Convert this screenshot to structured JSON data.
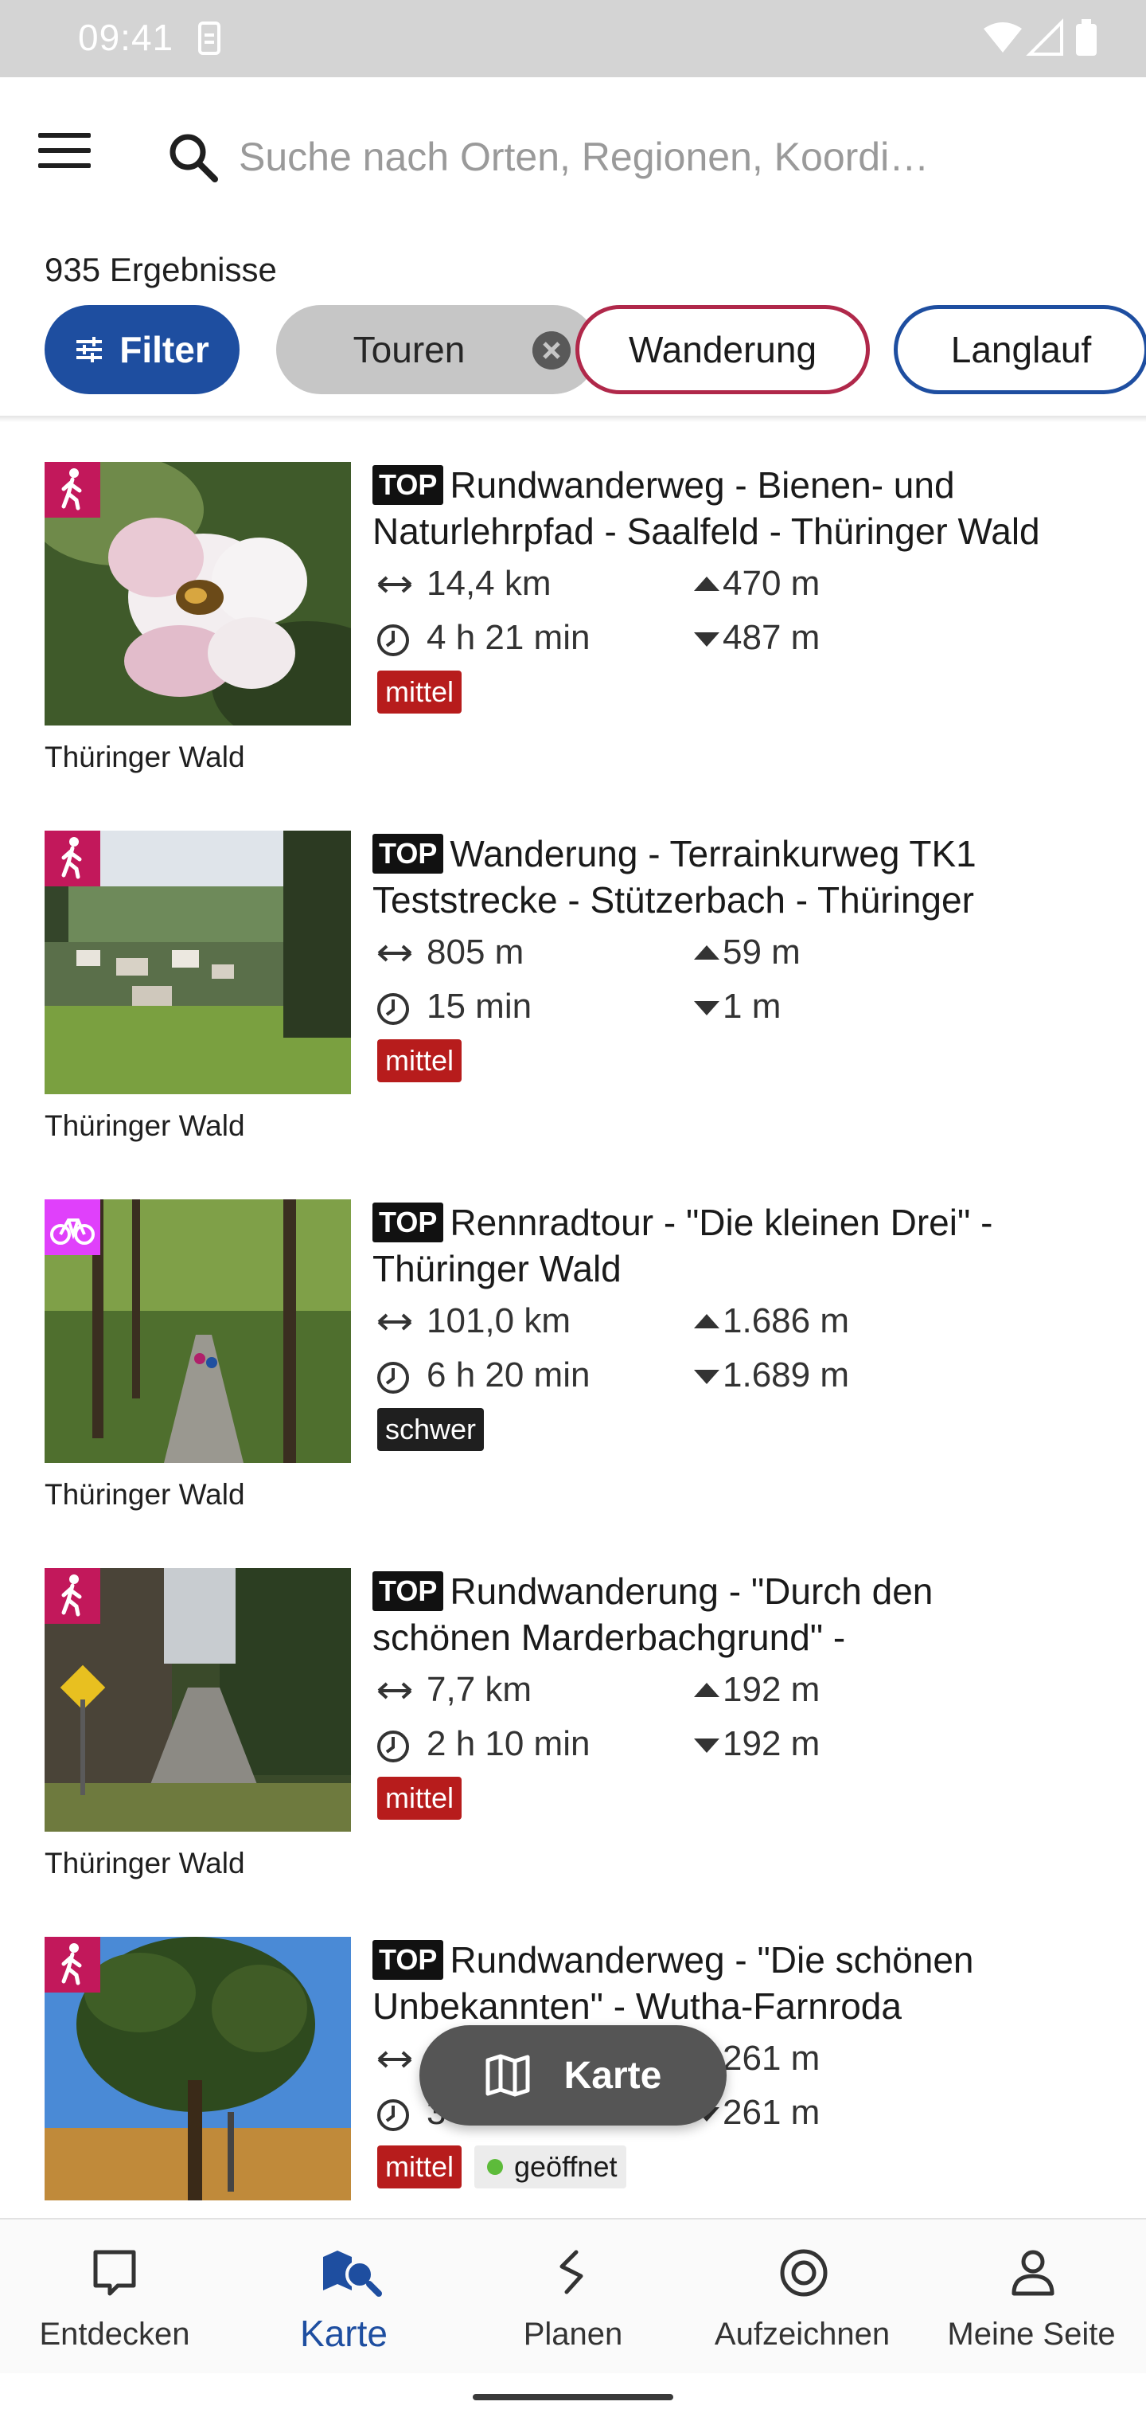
{
  "status_bar": {
    "time": "09:41"
  },
  "search": {
    "placeholder": "Suche nach Orten, Regionen, Koordi…"
  },
  "results": {
    "count_label": "935 Ergebnisse"
  },
  "chips": {
    "filter": "Filter",
    "touren": "Touren",
    "wanderung": "Wanderung",
    "langlauf": "Langlauf"
  },
  "colors": {
    "brand_blue": "#1e4ea0",
    "wanderung_border": "#b0284a",
    "difficulty_mittel": "#b71c1c",
    "difficulty_schwer": "#1f1f1f",
    "hike_badge": "#c2185b",
    "bike_badge": "#e040fb"
  },
  "tours": [
    {
      "category_icon": "hiking-icon",
      "top_label": "TOP",
      "title": "Rundwanderweg - Bienen- und Naturlehrpfad - Saalfeld - Thüringer Wald",
      "distance": "14,4 km",
      "duration": "4 h 21 min",
      "ascent": "470 m",
      "descent": "487 m",
      "difficulty": "mittel",
      "region": "Thüringer Wald"
    },
    {
      "category_icon": "hiking-icon",
      "top_label": "TOP",
      "title": "Wanderung - Terrainkurweg TK1 Teststrecke  -  Stützerbach - Thüringer",
      "distance": "805 m",
      "duration": "15 min",
      "ascent": "59 m",
      "descent": "1 m",
      "difficulty": "mittel",
      "region": "Thüringer Wald"
    },
    {
      "category_icon": "road-bike-icon",
      "top_label": "TOP",
      "title": "Rennradtour - \"Die kleinen Drei\" - Thüringer Wald",
      "distance": "101,0 km",
      "duration": "6 h 20 min",
      "ascent": "1.686 m",
      "descent": "1.689 m",
      "difficulty": "schwer",
      "region": "Thüringer Wald"
    },
    {
      "category_icon": "hiking-icon",
      "top_label": "TOP",
      "title": "Rundwanderung - \"Durch den schönen Marderbachgrund\" -",
      "distance": "7,7 km",
      "duration": "2 h 10 min",
      "ascent": "192 m",
      "descent": "192 m",
      "difficulty": "mittel",
      "region": "Thüringer Wald"
    },
    {
      "category_icon": "hiking-icon",
      "top_label": "TOP",
      "title": "Rundwanderweg - \"Die schönen Unbekannten\" - Wutha-Farnroda",
      "distance": "",
      "duration": "3",
      "ascent": "261 m",
      "descent": "261 m",
      "difficulty": "mittel",
      "status": "geöffnet",
      "region": ""
    }
  ],
  "map_button": {
    "label": "Karte"
  },
  "bottom_nav": [
    {
      "label": "Entdecken",
      "icon": "discover-icon"
    },
    {
      "label": "Karte",
      "icon": "map-icon",
      "active": true
    },
    {
      "label": "Planen",
      "icon": "plan-route-icon"
    },
    {
      "label": "Aufzeichnen",
      "icon": "record-icon"
    },
    {
      "label": "Meine Seite",
      "icon": "profile-icon"
    }
  ]
}
